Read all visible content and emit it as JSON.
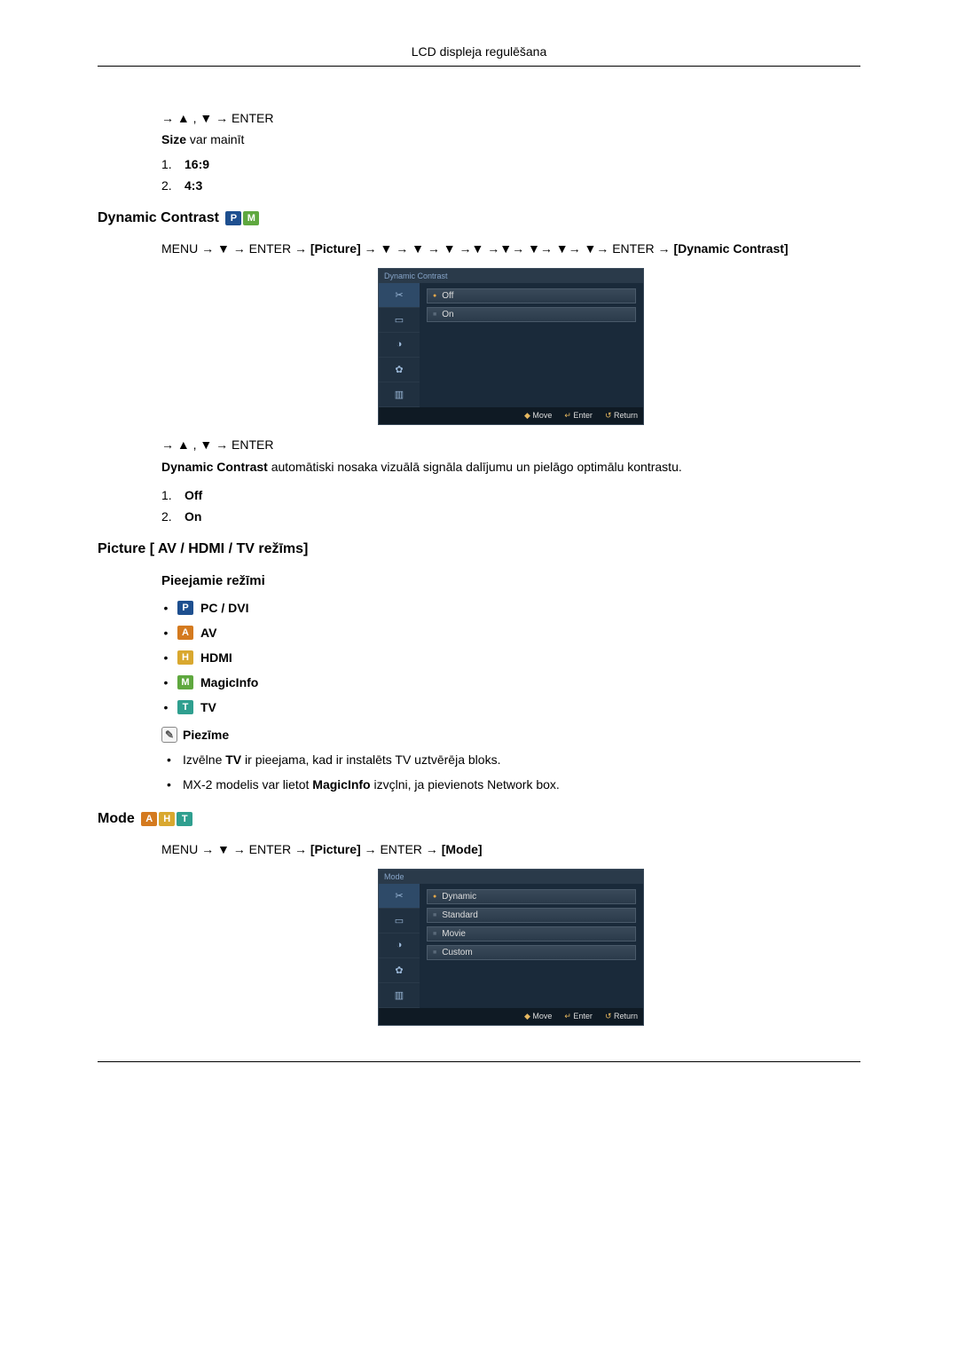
{
  "header": {
    "title": "LCD displeja regulēšana"
  },
  "intro": {
    "nav": "→ ▲ , ▼ → ENTER",
    "size_prefix": "Size",
    "size_suffix": " var mainīt",
    "items": [
      {
        "n": "1.",
        "v": "16:9"
      },
      {
        "n": "2.",
        "v": "4:3"
      }
    ]
  },
  "dynamic": {
    "heading": "Dynamic Contrast",
    "badges": [
      "P",
      "M"
    ],
    "path_pre": "MENU → ▼ → ENTER → ",
    "path_bracket1": "[Picture]",
    "path_mid": " → ▼ → ▼ → ▼ →▼ →▼→ ▼→ ▼→ ▼→ ENTER → ",
    "path_bracket2": "[Dynamic Contrast]",
    "osd": {
      "title": "Dynamic Contrast",
      "options": [
        {
          "label": "Off",
          "sel": true
        },
        {
          "label": "On",
          "sel": false
        }
      ],
      "footer": {
        "move": "Move",
        "enter": "Enter",
        "return": "Return"
      }
    },
    "nav2": "→ ▲ , ▼ → ENTER",
    "desc_b": "Dynamic Contrast",
    "desc_rest": " automātiski nosaka vizuālā signāla dalījumu un pielāgo optimālu kontrastu.",
    "items": [
      {
        "n": "1.",
        "v": "Off"
      },
      {
        "n": "2.",
        "v": "On"
      }
    ]
  },
  "picture": {
    "heading": "Picture [ AV / HDMI / TV režīms]",
    "sub": "Pieejamie režīmi",
    "modes": [
      {
        "badge": "P",
        "label": "PC / DVI"
      },
      {
        "badge": "A",
        "label": "AV"
      },
      {
        "badge": "H",
        "label": "HDMI"
      },
      {
        "badge": "M",
        "label": "MagicInfo"
      },
      {
        "badge": "T",
        "label": "TV"
      }
    ],
    "note_h": "Piezīme",
    "notes": [
      {
        "pre": "Izvēlne ",
        "b1": "TV",
        "mid": " ir pieejama, kad ir instalēts TV uztvērēja bloks.",
        "b2": "",
        "tail": ""
      },
      {
        "pre": "MX-2 modelis var lietot ",
        "b1": "MagicInfo",
        "mid": " izvçlni, ja pievienots Network box.",
        "b2": "",
        "tail": ""
      }
    ]
  },
  "mode": {
    "heading": "Mode",
    "badges": [
      "A",
      "H",
      "T"
    ],
    "path_pre": "MENU → ▼ → ENTER → ",
    "path_b1": "[Picture]",
    "path_mid": " → ENTER → ",
    "path_b2": "[Mode]",
    "osd": {
      "title": "Mode",
      "options": [
        {
          "label": "Dynamic",
          "sel": true
        },
        {
          "label": "Standard",
          "sel": false
        },
        {
          "label": "Movie",
          "sel": false
        },
        {
          "label": "Custom",
          "sel": false
        }
      ],
      "footer": {
        "move": "Move",
        "enter": "Enter",
        "return": "Return"
      }
    }
  }
}
